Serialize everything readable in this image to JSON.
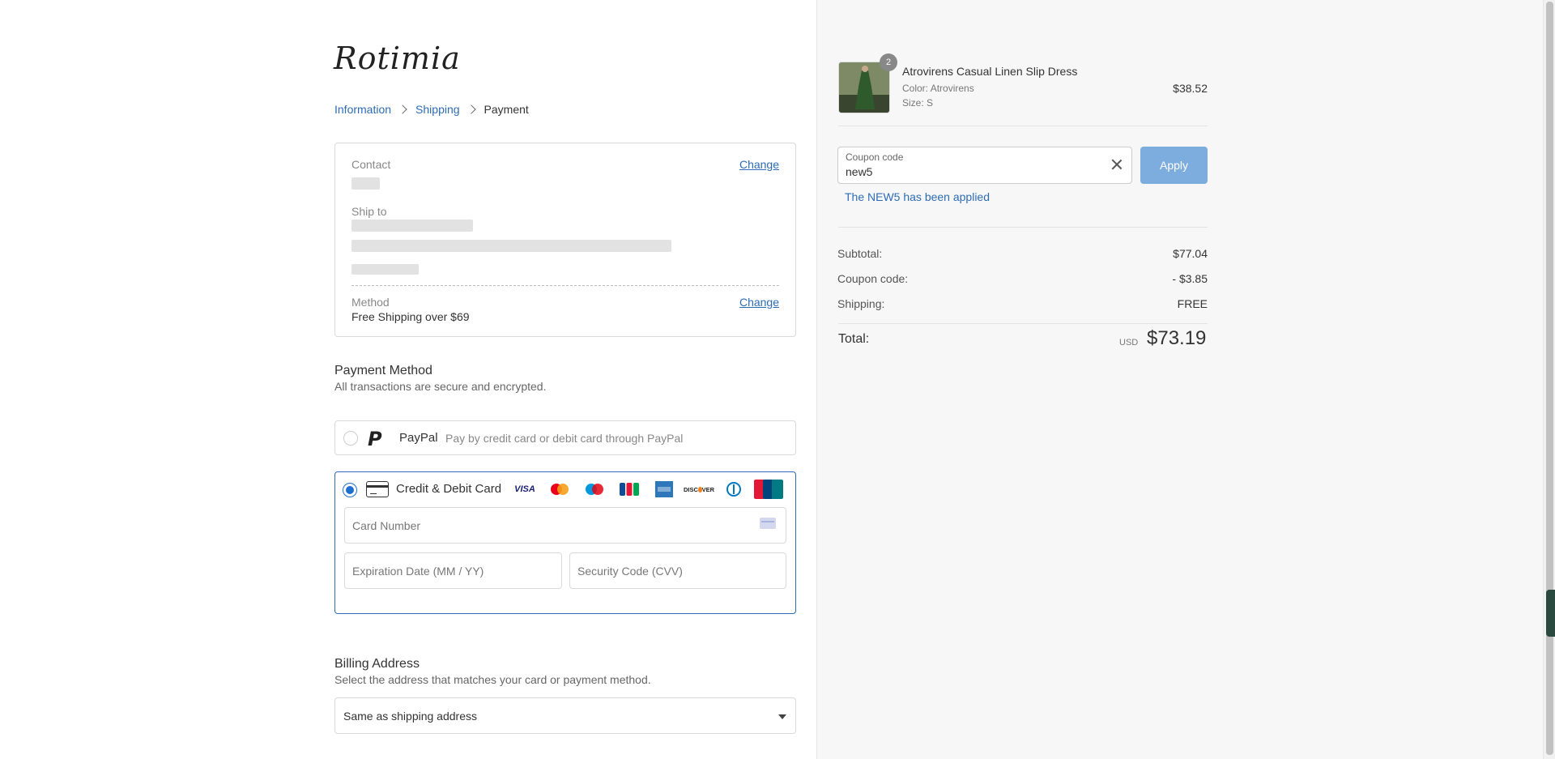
{
  "brand": {
    "logo_text": "Rotimia"
  },
  "breadcrumb": {
    "step1": "Information",
    "step2": "Shipping",
    "step3": "Payment"
  },
  "review": {
    "contact_label": "Contact",
    "ship_to_label": "Ship to",
    "method_label": "Method",
    "method_value": "Free Shipping over $69",
    "change_label": "Change"
  },
  "payment": {
    "title": "Payment Method",
    "subtitle": "All transactions are secure and encrypted.",
    "paypal_name": "PayPal",
    "paypal_desc": "Pay by credit card or debit card through PayPal",
    "card_name": "Credit & Debit Card",
    "card_brands": [
      "VISA",
      "Mastercard",
      "Maestro",
      "JCB",
      "American Express",
      "DISCOVER",
      "Diners Club",
      "UnionPay"
    ],
    "card_number_placeholder": "Card Number",
    "expiry_placeholder": "Expiration Date (MM / YY)",
    "cvv_placeholder": "Security Code (CVV)",
    "selected": "card"
  },
  "billing": {
    "title": "Billing Address",
    "subtitle": "Select the address that matches your card or payment method.",
    "selected_option": "Same as shipping address"
  },
  "order": {
    "product_name": "Atrovirens Casual Linen Slip Dress",
    "quantity": "2",
    "color_label": "Color:",
    "color_value": "Atrovirens",
    "size_label": "Size:",
    "size_value": "S",
    "price": "$38.52"
  },
  "coupon": {
    "label": "Coupon code",
    "value": "new5",
    "apply_label": "Apply",
    "message": "The NEW5 has been applied"
  },
  "summary": {
    "subtotal_label": "Subtotal:",
    "subtotal_value": "$77.04",
    "coupon_label": "Coupon code:",
    "coupon_value": "- $3.85",
    "shipping_label": "Shipping:",
    "shipping_value": "FREE",
    "total_label": "Total:",
    "currency": "USD",
    "total_value": "$73.19"
  },
  "colors": {
    "accent": "#2d6cb5",
    "apply_button": "#7dadde",
    "radio_selected": "#1f6fd1"
  }
}
